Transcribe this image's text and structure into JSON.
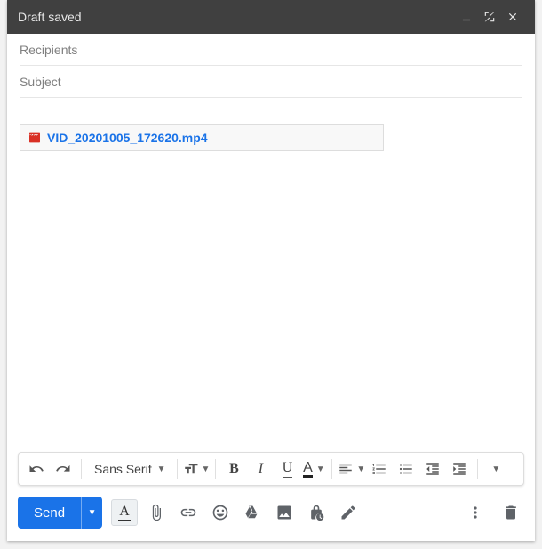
{
  "titlebar": {
    "title": "Draft saved"
  },
  "fields": {
    "recipients_placeholder": "Recipients",
    "subject_placeholder": "Subject"
  },
  "attachment": {
    "filename": "VID_20201005_172620.mp4"
  },
  "format": {
    "font_name": "Sans Serif",
    "bold": "B",
    "italic": "I",
    "underline": "U",
    "textcolor": "A"
  },
  "send": {
    "label": "Send"
  }
}
